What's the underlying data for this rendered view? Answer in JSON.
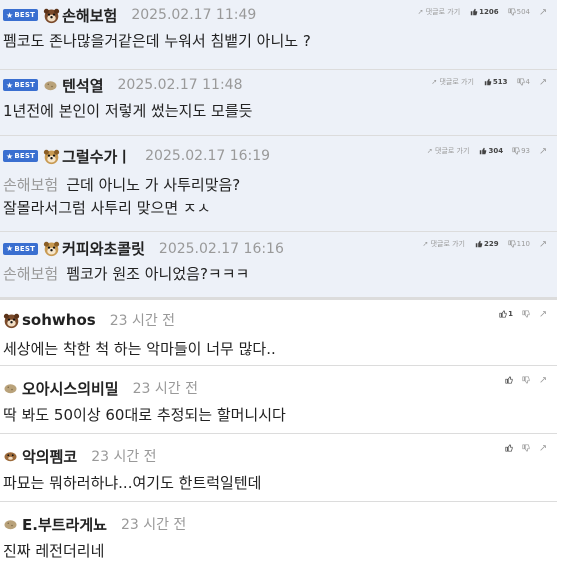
{
  "best_badge": "BEST",
  "go_label": "댓글로 가기",
  "comments": [
    {
      "nick": "손해보험",
      "date": "2025.02.17 11:49",
      "up": "1206",
      "down": "504",
      "mention": "",
      "lines": [
        "펨코도 존나많을거같은데 누워서 침뱉기 아니노 ?"
      ]
    },
    {
      "nick": "텐석열",
      "date": "2025.02.17 11:48",
      "up": "513",
      "down": "4",
      "mention": "",
      "lines": [
        "1년전에 본인이 저렇게 썼는지도 모를듯"
      ]
    },
    {
      "nick": "그럴수가ㅣ",
      "date": "2025.02.17 16:19",
      "up": "304",
      "down": "93",
      "mention": "손해보험",
      "lines": [
        "근데 아니노 가 사투리맞음?",
        "잘몰라서그럼 사투리 맞으면 ㅈㅅ"
      ]
    },
    {
      "nick": "커피와초콜릿",
      "date": "2025.02.17 16:16",
      "up": "229",
      "down": "110",
      "mention": "손해보험",
      "lines": [
        "펨코가 원조 아니었음?ㅋㅋㅋ"
      ]
    },
    {
      "nick": "sohwhos",
      "date": "23 시간 전",
      "up": "1",
      "down": "",
      "lines": [
        "세상에는 착한 척 하는 악마들이 너무 많다.."
      ]
    },
    {
      "nick": "오아시스의비밀",
      "date": "23 시간 전",
      "up": "",
      "down": "",
      "lines": [
        "딱 봐도 50이상 60대로 추정되는 할머니시다"
      ]
    },
    {
      "nick": "악의펨코",
      "date": "23 시간 전",
      "up": "",
      "down": "",
      "lines": [
        "파묘는 뭐하러하냐...여기도 한트럭일텐데"
      ]
    },
    {
      "nick": "E.부트라게뇨",
      "date": "23 시간 전",
      "up": "",
      "down": "",
      "lines": [
        "진짜 레전더리네"
      ]
    }
  ],
  "colors": {
    "best_bg": "#edf1f8",
    "badge": "#3a6fd0",
    "meta": "#999999"
  },
  "icons": {
    "avatar_large": "dog-face-icon",
    "avatar_small": "potato-icon",
    "up": "thumbs-up-icon",
    "down": "thumbs-down-icon",
    "go": "arrow-icon"
  }
}
